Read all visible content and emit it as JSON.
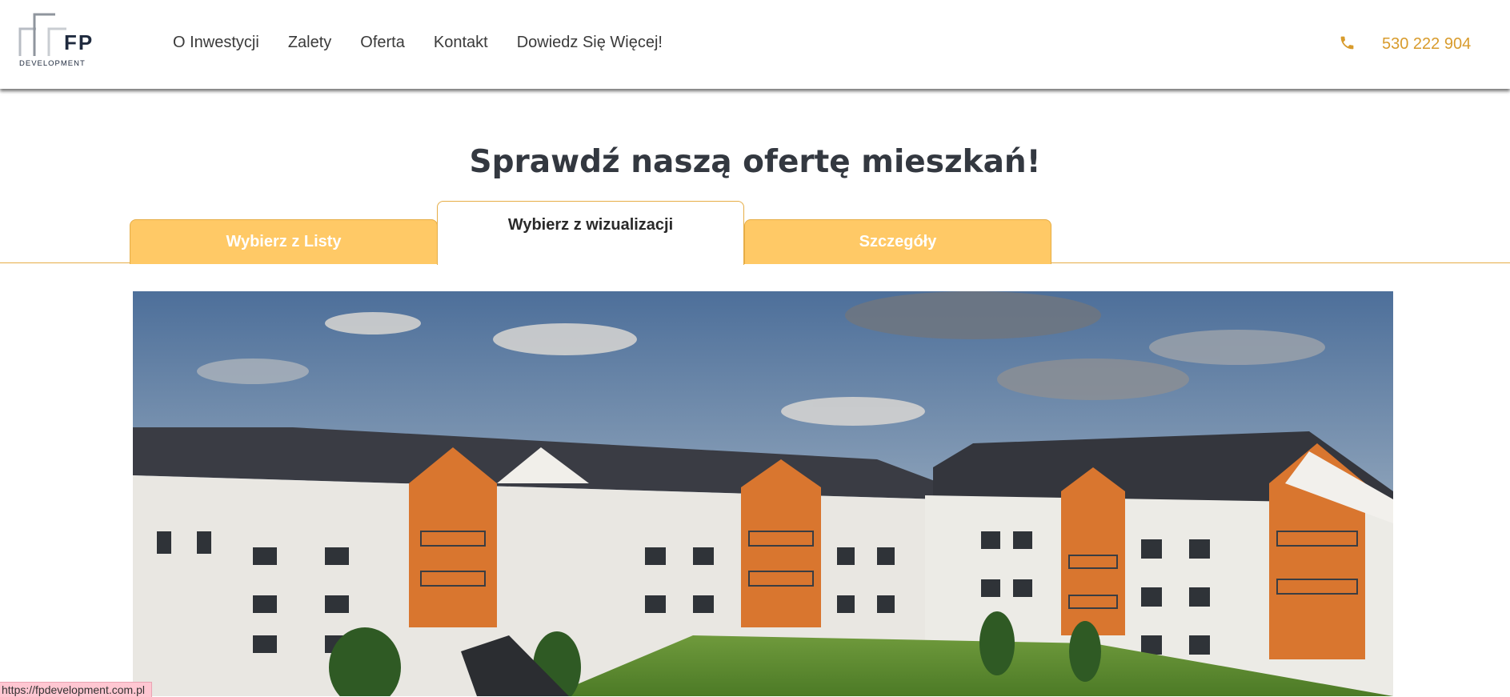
{
  "brand": {
    "logo_main": "FP",
    "logo_sub": "DEVELOPMENT",
    "name": "FP Development"
  },
  "nav": {
    "items": [
      {
        "label": "O Inwestycji"
      },
      {
        "label": "Zalety"
      },
      {
        "label": "Oferta"
      },
      {
        "label": "Kontakt"
      },
      {
        "label": "Dowiedz Się Więcej!"
      }
    ]
  },
  "contact": {
    "phone": "530 222 904",
    "icon": "phone-icon"
  },
  "section": {
    "title": "Sprawdź naszą ofertę mieszkań!"
  },
  "tabs": [
    {
      "label": "Wybierz z Listy",
      "active": false
    },
    {
      "label": "Wybierz z wizualizacji",
      "active": true
    },
    {
      "label": "Szczegóły",
      "active": false
    }
  ],
  "colors": {
    "accent": "#ffc966",
    "accent_border": "#e6ad46",
    "phone_text": "#d89b2c",
    "title_text": "#333840"
  },
  "status_bar": {
    "url": "https://fpdevelopment.com.pl"
  }
}
